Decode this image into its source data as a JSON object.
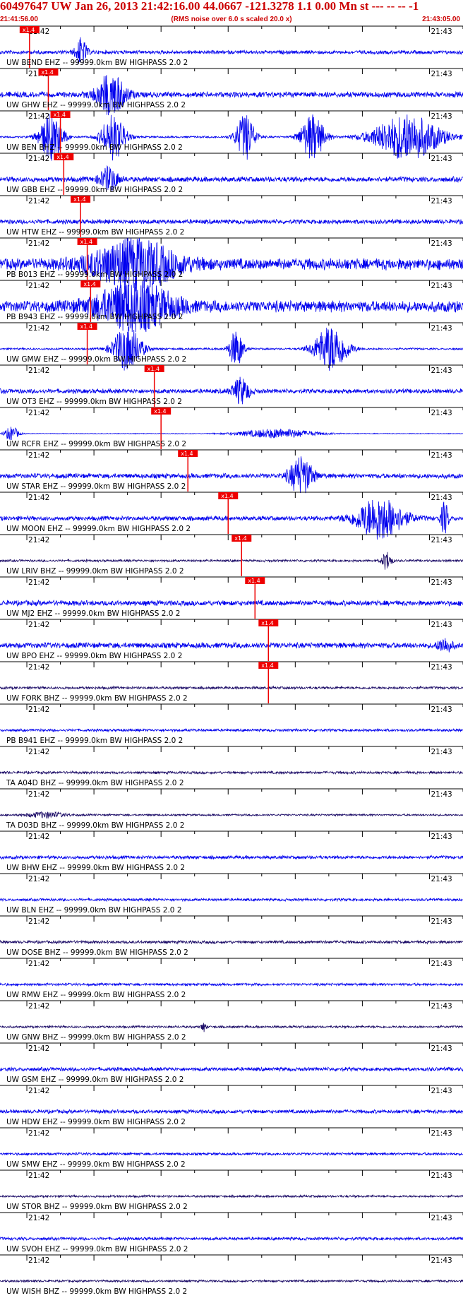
{
  "header": {
    "title": "60497647 UW Jan 26, 2013 21:42:16.00   44.0667 -121.3278  1.1 0.00 Mn st --- -- --  -1",
    "start_time": "21:41:56.00",
    "noise_note": "(RMS noise over 6.0 s scaled 20.0 x)",
    "end_time": "21:43:05.00"
  },
  "colors": {
    "trace_blue": "#0000ee",
    "trace_dark": "#1a0a66",
    "pick": "#ee0000",
    "axis": "#000000"
  },
  "chart_data": {
    "type": "line",
    "x_unit": "time (UTC)",
    "x_range": [
      "21:41:56.00",
      "21:43:05.00"
    ],
    "tick_labels": [
      "21:42",
      "21:43"
    ],
    "pick_label": "x1.4",
    "series": [
      {
        "name": "UW BEND EHZ -- 99999.0km BW  HIGHPASS  2.0  2",
        "color": "blue",
        "pick": "21:42:00.4",
        "amp": 0.1,
        "bursts": [
          [
            0.175,
            0.012,
            0.6
          ]
        ]
      },
      {
        "name": "UW GHW EHZ -- 99999.0km BW  HIGHPASS  2.0  2",
        "color": "blue",
        "pick": "21:42:03.2",
        "amp": 0.15,
        "bursts": [
          [
            0.24,
            0.03,
            0.9
          ]
        ]
      },
      {
        "name": "UW BEN BHZ -- 99999.0km BW  HIGHPASS  2.0  2",
        "color": "blue",
        "pick": "21:42:05.0",
        "amp": 0.05,
        "bursts": [
          [
            0.11,
            0.025,
            1.0
          ],
          [
            0.245,
            0.025,
            1.0
          ],
          [
            0.53,
            0.02,
            1.0
          ],
          [
            0.675,
            0.025,
            1.0
          ],
          [
            0.88,
            0.07,
            1.0
          ]
        ]
      },
      {
        "name": "UW GBB EHZ -- 99999.0km BW  HIGHPASS  2.0  2",
        "color": "blue",
        "pick": "21:42:05.5",
        "amp": 0.14,
        "bursts": [
          [
            0.235,
            0.02,
            0.5
          ]
        ]
      },
      {
        "name": "UW HTW EHZ -- 99999.0km BW  HIGHPASS  2.0  2",
        "color": "blue",
        "pick": "21:42:08.0",
        "amp": 0.12,
        "bursts": []
      },
      {
        "name": "PB B013 EHZ -- 99999.0km BW  HIGHPASS  2.0  2",
        "color": "blue",
        "pick": "21:42:09.0",
        "amp": 0.3,
        "bursts": [
          [
            0.29,
            0.09,
            1.0
          ]
        ]
      },
      {
        "name": "PB B943 EHZ -- 99999.0km BW  HIGHPASS  2.0  2",
        "color": "blue",
        "pick": "21:42:09.5",
        "amp": 0.3,
        "bursts": [
          [
            0.29,
            0.08,
            1.0
          ]
        ]
      },
      {
        "name": "UW GMW EHZ -- 99999.0km BW  HIGHPASS  2.0  2",
        "color": "blue",
        "pick": "21:42:09.0",
        "amp": 0.05,
        "bursts": [
          [
            0.275,
            0.03,
            1.0
          ],
          [
            0.51,
            0.015,
            0.8
          ],
          [
            0.715,
            0.035,
            1.0
          ]
        ]
      },
      {
        "name": "UW OT3 EHZ -- 99999.0km BW  HIGHPASS  2.0  2",
        "color": "blue",
        "pick": "21:42:19.0",
        "amp": 0.12,
        "bursts": [
          [
            0.52,
            0.018,
            0.55
          ]
        ]
      },
      {
        "name": "UW RCFR EHZ -- 99999.0km BW  HIGHPASS  2.0  2",
        "color": "blue",
        "pick": "21:42:20.0",
        "amp": 0.02,
        "bursts": [
          [
            0.025,
            0.015,
            0.3
          ],
          [
            0.6,
            0.08,
            0.2
          ]
        ]
      },
      {
        "name": "UW STAR EHZ -- 99999.0km BW  HIGHPASS  2.0  2",
        "color": "blue",
        "pick": "21:42:24.0",
        "amp": 0.13,
        "bursts": [
          [
            0.65,
            0.025,
            0.8
          ]
        ]
      },
      {
        "name": "UW MOON EHZ -- 99999.0km BW  HIGHPASS  2.0  2",
        "color": "blue",
        "pick": "21:42:30.0",
        "amp": 0.12,
        "bursts": [
          [
            0.82,
            0.05,
            0.9
          ],
          [
            0.96,
            0.008,
            0.7
          ]
        ]
      },
      {
        "name": "UW LRIV BHZ -- 99999.0km BW  HIGHPASS  2.0  2",
        "color": "dark",
        "pick": "21:42:32.0",
        "amp": 0.06,
        "bursts": [
          [
            0.835,
            0.01,
            0.4
          ]
        ]
      },
      {
        "name": "UW MJ2 EHZ -- 99999.0km BW  HIGHPASS  2.0  2",
        "color": "blue",
        "pick": "21:42:34.0",
        "amp": 0.14,
        "bursts": []
      },
      {
        "name": "UW BPO EHZ -- 99999.0km BW  HIGHPASS  2.0  2",
        "color": "blue",
        "pick": "21:42:36.0",
        "amp": 0.15,
        "bursts": [
          [
            0.96,
            0.015,
            0.3
          ]
        ]
      },
      {
        "name": "UW FORK BHZ -- 99999.0km BW  HIGHPASS  2.0  2",
        "color": "dark",
        "pick": "21:42:36.0",
        "amp": 0.07,
        "bursts": []
      },
      {
        "name": "PB B941 EHZ -- 99999.0km BW  HIGHPASS  2.0  2",
        "color": "blue",
        "amp": 0.07,
        "bursts": []
      },
      {
        "name": "TA A04D BHZ -- 99999.0km BW  HIGHPASS  2.0  2",
        "color": "dark",
        "amp": 0.07,
        "bursts": []
      },
      {
        "name": "TA D03D BHZ -- 99999.0km BW  HIGHPASS  2.0  2",
        "color": "dark",
        "amp": 0.05,
        "bursts": [
          [
            0.1,
            0.04,
            0.12
          ]
        ]
      },
      {
        "name": "UW BHW EHZ -- 99999.0km BW  HIGHPASS  2.0  2",
        "color": "blue",
        "amp": 0.09,
        "bursts": []
      },
      {
        "name": "UW BLN EHZ -- 99999.0km BW  HIGHPASS  2.0  2",
        "color": "blue",
        "amp": 0.07,
        "bursts": []
      },
      {
        "name": "UW DOSE BHZ -- 99999.0km BW  HIGHPASS  2.0  2",
        "color": "dark",
        "amp": 0.08,
        "bursts": []
      },
      {
        "name": "UW RMW EHZ -- 99999.0km BW  HIGHPASS  2.0  2",
        "color": "blue",
        "amp": 0.07,
        "bursts": []
      },
      {
        "name": "UW GNW BHZ -- 99999.0km BW  HIGHPASS  2.0  2",
        "color": "dark",
        "amp": 0.06,
        "bursts": [
          [
            0.44,
            0.005,
            0.2
          ]
        ]
      },
      {
        "name": "UW GSM EHZ -- 99999.0km BW  HIGHPASS  2.0  2",
        "color": "blue",
        "amp": 0.1,
        "bursts": []
      },
      {
        "name": "UW HDW EHZ -- 99999.0km BW  HIGHPASS  2.0  2",
        "color": "blue",
        "amp": 0.1,
        "bursts": []
      },
      {
        "name": "UW SMW EHZ -- 99999.0km BW  HIGHPASS  2.0  2",
        "color": "blue",
        "amp": 0.07,
        "bursts": []
      },
      {
        "name": "UW STOR BHZ -- 99999.0km BW  HIGHPASS  2.0  2",
        "color": "dark",
        "amp": 0.06,
        "bursts": []
      },
      {
        "name": "UW SVOH EHZ -- 99999.0km BW  HIGHPASS  2.0  2",
        "color": "blue",
        "amp": 0.08,
        "bursts": []
      },
      {
        "name": "UW WISH BHZ -- 99999.0km BW  HIGHPASS  2.0  2",
        "color": "dark",
        "amp": 0.06,
        "bursts": []
      }
    ]
  }
}
